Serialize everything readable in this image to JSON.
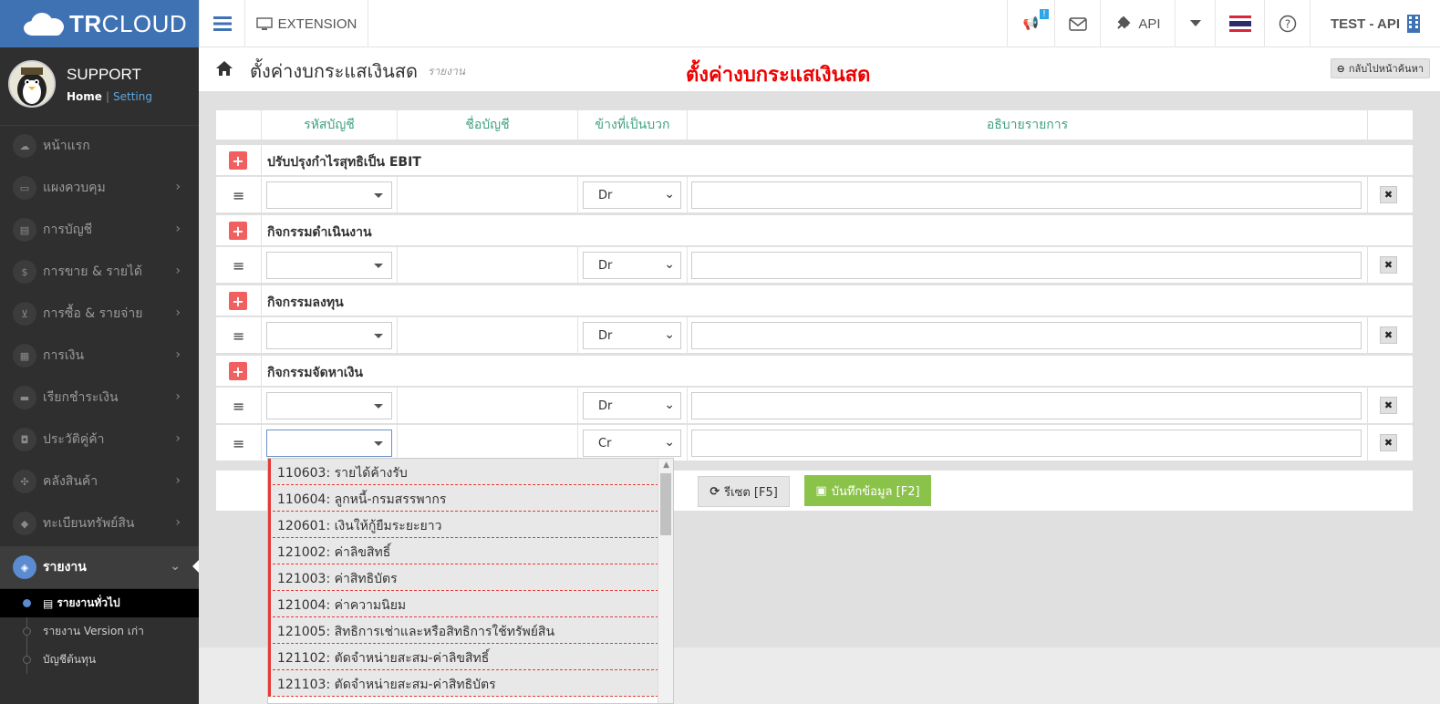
{
  "topbar": {
    "brand_bold": "TR",
    "brand_light": "CLOUD",
    "extension_label": "EXTENSION",
    "badge": "!",
    "api_label": "API",
    "user_label": "TEST - API"
  },
  "profile": {
    "name": "SUPPORT",
    "home_link": "Home",
    "separator": "|",
    "setting_link": "Setting"
  },
  "sidebar": {
    "items": [
      {
        "label": "หน้าแรก",
        "icon": "cloud-icon"
      },
      {
        "label": "แผงควบคุม",
        "icon": "monitor-icon"
      },
      {
        "label": "การบัญชี",
        "icon": "book-icon"
      },
      {
        "label": "การขาย & รายได้",
        "icon": "dollar-icon"
      },
      {
        "label": "การซื้อ & รายจ่าย",
        "icon": "cart-icon"
      },
      {
        "label": "การเงิน",
        "icon": "calendar-icon"
      },
      {
        "label": "เรียกชำระเงิน",
        "icon": "card-icon"
      },
      {
        "label": "ประวัติคู่ค้า",
        "icon": "contact-icon"
      },
      {
        "label": "คลังสินค้า",
        "icon": "cubes-icon"
      },
      {
        "label": "ทะเบียนทรัพย์สิน",
        "icon": "diamond-icon"
      },
      {
        "label": "รายงาน",
        "icon": "report-icon"
      }
    ],
    "subitems": [
      {
        "label": "รายงานทั่วไป"
      },
      {
        "label": "รายงาน Version เก่า"
      },
      {
        "label": "บัญชีต้นทุน"
      }
    ]
  },
  "page": {
    "title": "ตั้งค่างบกระแสเงินสด",
    "subtitle": "รายงาน",
    "red_title": "ตั้งค่างบกระแสเงินสด",
    "back_button": "กลับไปหน้าค้นหา"
  },
  "table": {
    "headers": [
      "รหัสบัญชี",
      "ชื่อบัญชี",
      "ข้างที่เป็นบวก",
      "อธิบายรายการ"
    ],
    "groups": [
      {
        "label": "ปรับปรุงกำไรสุทธิเป็น EBIT",
        "rows": [
          {
            "side": "Dr"
          }
        ]
      },
      {
        "label": "กิจกรรมดำเนินงาน",
        "rows": [
          {
            "side": "Dr"
          }
        ]
      },
      {
        "label": "กิจกรรมลงทุน",
        "rows": [
          {
            "side": "Dr"
          }
        ]
      },
      {
        "label": "กิจกรรมจัดหาเงิน",
        "rows": [
          {
            "side": "Dr"
          },
          {
            "side": "Cr"
          }
        ]
      }
    ]
  },
  "actions": {
    "reset": "รีเซต [F5]",
    "save": "บันทึกข้อมูล [F2]"
  },
  "dropdown": {
    "options": [
      "110603: รายได้ค้างรับ",
      "110604: ลูกหนี้-กรมสรรพากร",
      "120601: เงินให้กู้ยืมระยะยาว",
      "121002: ค่าลิขสิทธิ์",
      "121003: ค่าสิทธิบัตร",
      "121004: ค่าความนิยม",
      "121005: สิทธิการเช่าและหรือสิทธิการใช้ทรัพย์สิน",
      "121102: ตัดจำหน่ายสะสม-ค่าลิขสิทธิ์",
      "121103: ตัดจำหน่ายสะสม-ค่าสิทธิบัตร"
    ]
  },
  "colors": {
    "brand": "#3f72b3",
    "sidebar_bg": "#2f2f2f",
    "header_text": "#3fa27d",
    "plus_button": "#f06060",
    "save_button": "#8bc34a",
    "red_title": "#ee0000"
  }
}
